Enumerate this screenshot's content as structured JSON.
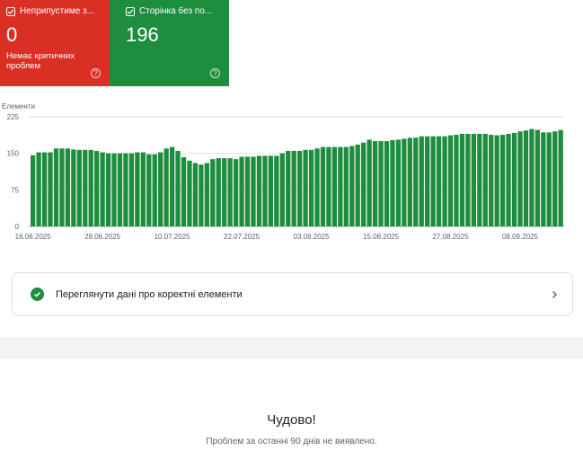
{
  "cards": {
    "error": {
      "label": "Неприпустиме з...",
      "count": "0",
      "subtitle": "Немає критичних проблем",
      "color": "#d93025"
    },
    "valid": {
      "label": "Сторінка без по...",
      "count": "196",
      "color": "#1e8e3e"
    }
  },
  "chart_data": {
    "type": "bar",
    "ylabel": "Елементи",
    "ylim": [
      0,
      225
    ],
    "yticks": [
      "0",
      "75",
      "150",
      "225"
    ],
    "x_tick_labels": [
      "16.06.2025",
      "28.06.2025",
      "10.07.2025",
      "22.07.2025",
      "03.08.2025",
      "15.08.2025",
      "27.08.2025",
      "08.09.2025"
    ],
    "color": "#1e8e3e",
    "grid": true,
    "values": [
      146,
      152,
      152,
      152,
      160,
      160,
      160,
      158,
      157,
      157,
      157,
      155,
      152,
      150,
      150,
      150,
      150,
      150,
      152,
      152,
      148,
      148,
      152,
      160,
      163,
      155,
      142,
      135,
      130,
      127,
      130,
      138,
      140,
      140,
      140,
      138,
      143,
      143,
      143,
      145,
      145,
      145,
      145,
      150,
      155,
      155,
      155,
      157,
      157,
      160,
      163,
      163,
      163,
      163,
      163,
      165,
      168,
      172,
      178,
      175,
      175,
      175,
      177,
      178,
      180,
      182,
      182,
      185,
      185,
      185,
      185,
      185,
      187,
      188,
      190,
      190,
      190,
      190,
      190,
      188,
      187,
      188,
      190,
      192,
      195,
      197,
      200,
      198,
      193,
      193,
      195,
      198
    ]
  },
  "valid_link": {
    "label": "Переглянути дані про коректні елементи"
  },
  "empty_state": {
    "title": "Чудово!",
    "description": "Проблем за останні 90 днів не виявлено."
  }
}
